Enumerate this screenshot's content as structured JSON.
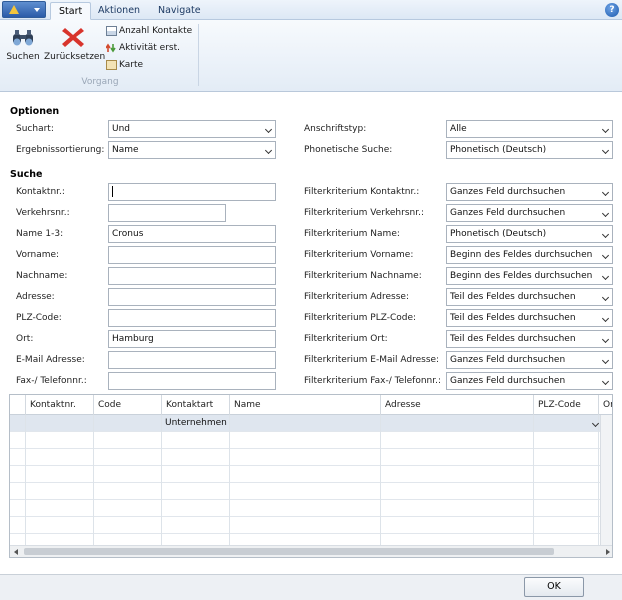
{
  "ribbon": {
    "tabs": [
      "Start",
      "Aktionen",
      "Navigate"
    ],
    "active_tab": "Start",
    "search_label": "Suchen",
    "reset_label": "Zurücksetzen",
    "small_actions": [
      "Anzahl Kontakte",
      "Aktivität erst.",
      "Karte"
    ],
    "group_label": "Vorgang"
  },
  "options": {
    "title": "Optionen",
    "suchart_label": "Suchart:",
    "suchart_value": "Und",
    "sort_label": "Ergebnissortierung:",
    "sort_value": "Name",
    "addr_label": "Anschriftstyp:",
    "addr_value": "Alle",
    "phon_label": "Phonetische Suche:",
    "phon_value": "Phonetisch (Deutsch)"
  },
  "search": {
    "title": "Suche",
    "rows": [
      {
        "label": "Kontaktnr.:",
        "value": "",
        "filter_label": "Filterkriterium Kontaktnr.:",
        "filter_value": "Ganzes Feld durchsuchen"
      },
      {
        "label": "Verkehrsnr.:",
        "value": "",
        "filter_label": "Filterkriterium Verkehrsnr.:",
        "filter_value": "Ganzes Feld durchsuchen"
      },
      {
        "label": "Name 1-3:",
        "value": "Cronus",
        "filter_label": "Filterkriterium Name:",
        "filter_value": "Phonetisch (Deutsch)"
      },
      {
        "label": "Vorname:",
        "value": "",
        "filter_label": "Filterkriterium Vorname:",
        "filter_value": "Beginn des Feldes durchsuchen"
      },
      {
        "label": "Nachname:",
        "value": "",
        "filter_label": "Filterkriterium Nachname:",
        "filter_value": "Beginn des Feldes durchsuchen"
      },
      {
        "label": "Adresse:",
        "value": "",
        "filter_label": "Filterkriterium Adresse:",
        "filter_value": "Teil des Feldes durchsuchen"
      },
      {
        "label": "PLZ-Code:",
        "value": "",
        "filter_label": "Filterkriterium PLZ-Code:",
        "filter_value": "Teil des Feldes durchsuchen"
      },
      {
        "label": "Ort:",
        "value": "Hamburg",
        "filter_label": "Filterkriterium Ort:",
        "filter_value": "Teil des Feldes durchsuchen"
      },
      {
        "label": "E-Mail Adresse:",
        "value": "",
        "filter_label": "Filterkriterium E-Mail Adresse:",
        "filter_value": "Ganzes Feld durchsuchen"
      },
      {
        "label": "Fax-/ Telefonnr.:",
        "value": "",
        "filter_label": "Filterkriterium Fax-/ Telefonnr.:",
        "filter_value": "Ganzes Feld durchsuchen"
      }
    ]
  },
  "grid": {
    "columns": [
      "Kontaktnr.",
      "Code",
      "Kontaktart",
      "Name",
      "Adresse",
      "PLZ-Code",
      "Or"
    ],
    "first_row": [
      "",
      "",
      "Unternehmen",
      "",
      "",
      "",
      ""
    ]
  },
  "footer": {
    "ok_label": "OK"
  }
}
